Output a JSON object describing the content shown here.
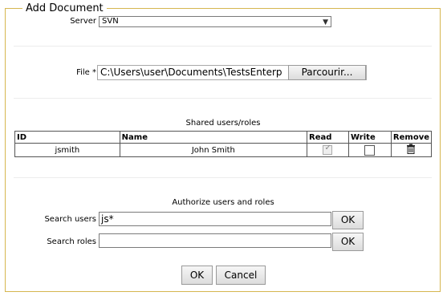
{
  "legend": "Add Document",
  "server": {
    "label": "Server",
    "value": "SVN"
  },
  "file": {
    "label": "File *",
    "value": "C:\\Users\\user\\Documents\\TestsEnterp",
    "browse_label": "Parcourir..."
  },
  "shared": {
    "title": "Shared users/roles",
    "columns": {
      "id": "ID",
      "name": "Name",
      "read": "Read",
      "write": "Write",
      "remove": "Remove"
    },
    "rows": [
      {
        "id": "jsmith",
        "name": "John Smith",
        "read": true,
        "write": false
      }
    ]
  },
  "authorize": {
    "title": "Authorize users and roles",
    "search_users_label": "Search users",
    "search_users_value": "js*",
    "search_roles_label": "Search roles",
    "search_roles_value": "",
    "ok_label": "OK"
  },
  "footer": {
    "ok_label": "OK",
    "cancel_label": "Cancel"
  },
  "colors": {
    "border_accent": "#d6b64f"
  }
}
